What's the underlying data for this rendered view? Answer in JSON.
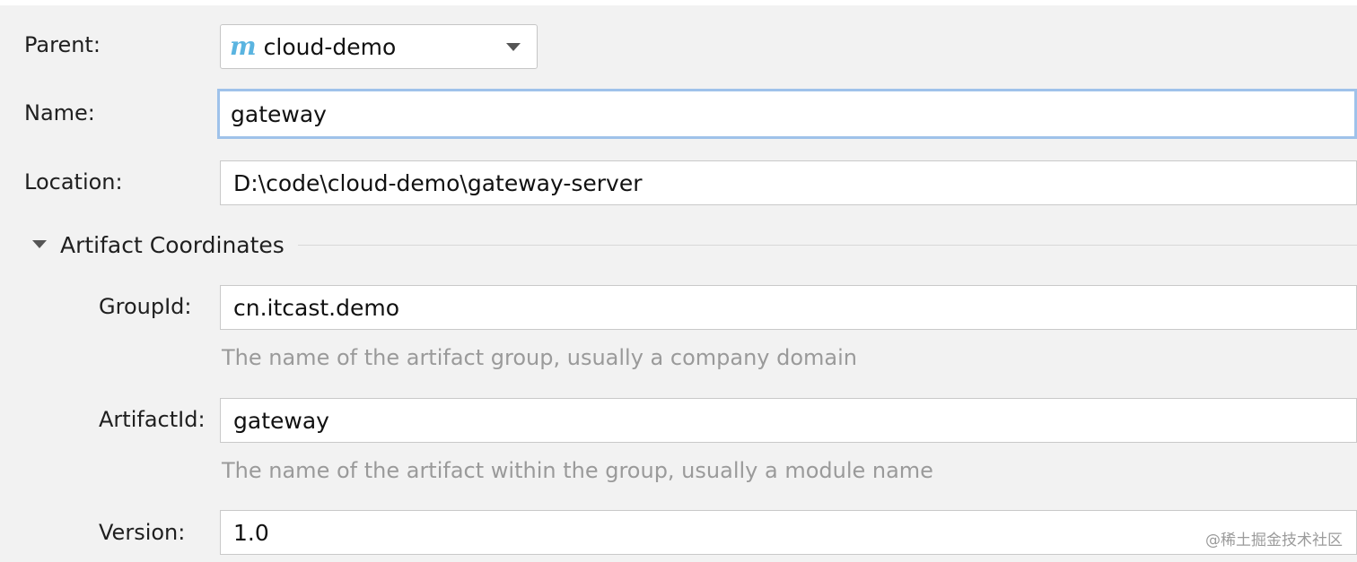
{
  "form": {
    "parent": {
      "label": "Parent:",
      "value": "cloud-demo",
      "icon": "maven-module-icon"
    },
    "name": {
      "label": "Name:",
      "value": "gateway"
    },
    "location": {
      "label": "Location:",
      "value": "D:\\code\\cloud-demo\\gateway-server"
    }
  },
  "artifact": {
    "section_title": "Artifact Coordinates",
    "group_id": {
      "label": "GroupId:",
      "value": "cn.itcast.demo",
      "hint": "The name of the artifact group, usually a company domain"
    },
    "artifact_id": {
      "label": "ArtifactId:",
      "value": "gateway",
      "hint": "The name of the artifact within the group, usually a module name"
    },
    "version": {
      "label": "Version:",
      "value": "1.0"
    }
  },
  "watermark": "@稀土掘金技术社区",
  "colors": {
    "focus_border": "#9fc2ea",
    "maven_icon": "#5ab4e0"
  }
}
